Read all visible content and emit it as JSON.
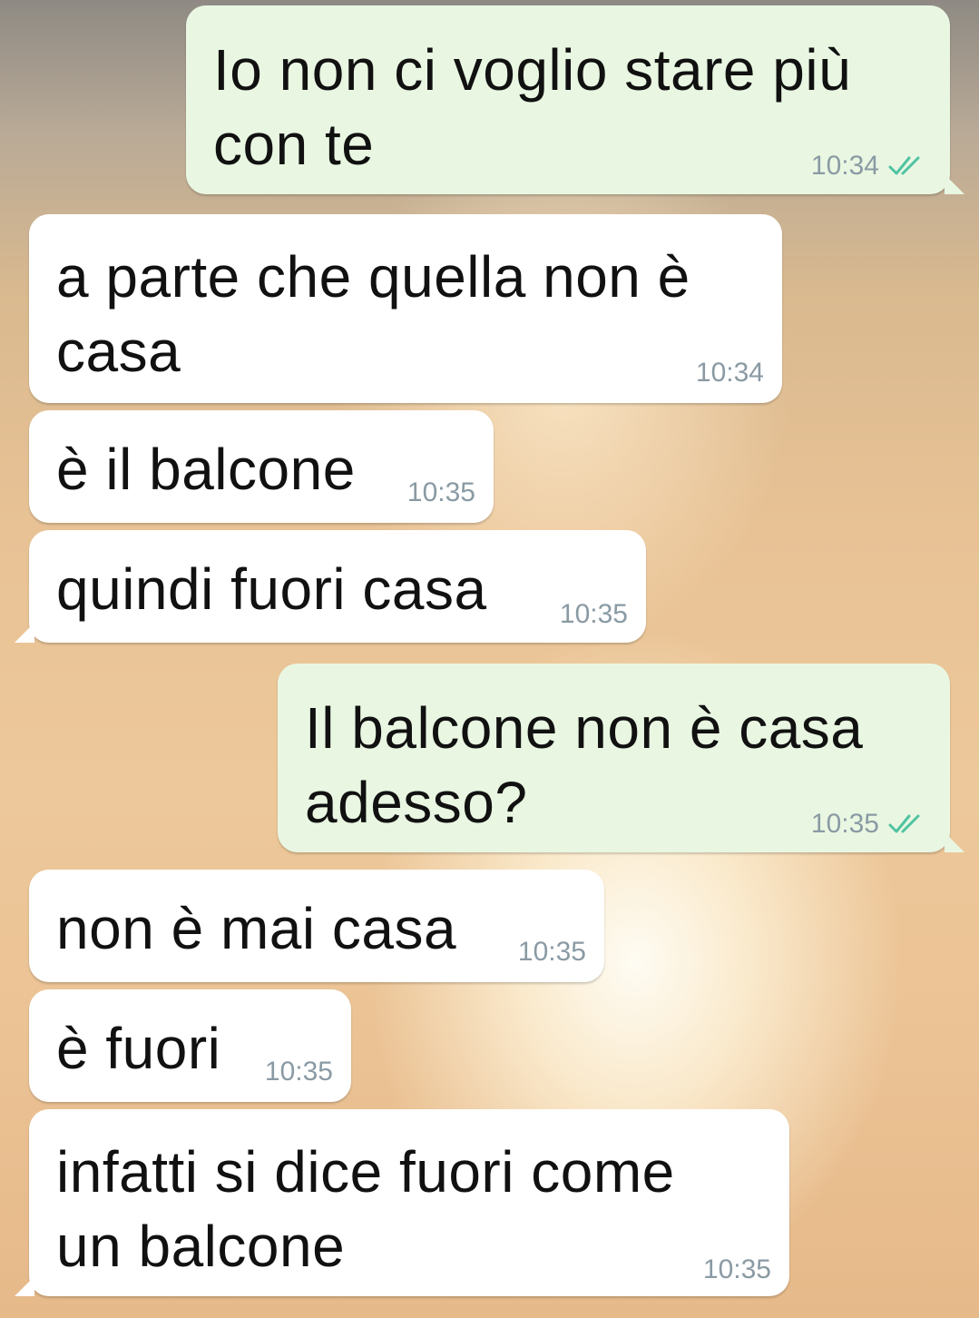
{
  "messages": [
    {
      "direction": "outgoing",
      "text": "Io non ci voglio stare più\ncon te",
      "time": "10:34",
      "status": "read"
    },
    {
      "direction": "incoming",
      "text": "a parte che quella non è\ncasa",
      "time": "10:34"
    },
    {
      "direction": "incoming",
      "text": "è il balcone",
      "time": "10:35"
    },
    {
      "direction": "incoming",
      "text": "quindi fuori casa",
      "time": "10:35"
    },
    {
      "direction": "outgoing",
      "text": "Il balcone non è casa\nadesso?",
      "time": "10:35",
      "status": "read"
    },
    {
      "direction": "incoming",
      "text": "non è mai casa",
      "time": "10:35"
    },
    {
      "direction": "incoming",
      "text": "è fuori",
      "time": "10:35"
    },
    {
      "direction": "incoming",
      "text": "infatti si dice fuori come\nun balcone",
      "time": "10:35"
    }
  ],
  "colors": {
    "incoming_bubble": "#ffffff",
    "outgoing_bubble": "#e9f7e2",
    "timestamp": "#8a9aa4",
    "read_ticks": "#4fc3a1"
  },
  "icons": {
    "read_status": "double-check-icon"
  }
}
